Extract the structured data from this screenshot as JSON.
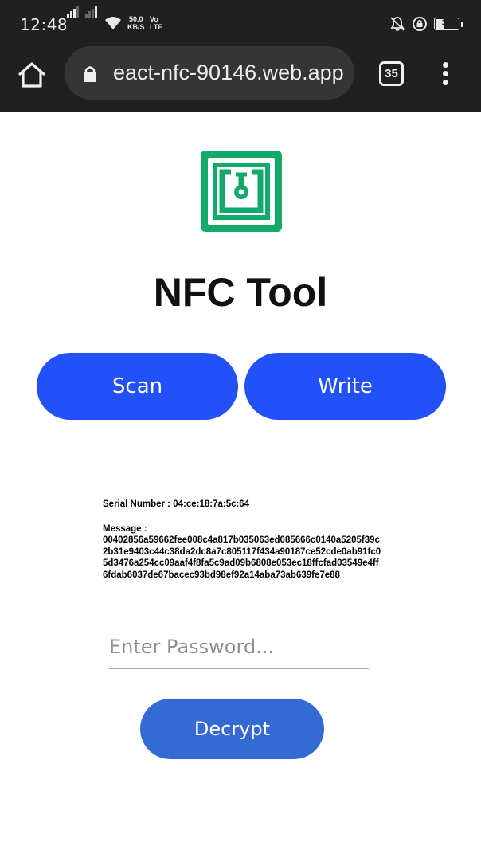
{
  "status_bar": {
    "time": "12:48",
    "net_speed_value": "50.0",
    "net_speed_unit": "KB/S",
    "volte_top": "Vo",
    "volte_bottom": "LTE",
    "battery": "38",
    "icons": [
      "signal-icon",
      "signal-icon",
      "wifi-icon",
      "mute-bell-icon",
      "data-saver-icon",
      "battery-icon"
    ]
  },
  "browser": {
    "url": "eact-nfc-90146.web.app",
    "tab_count": "35"
  },
  "app": {
    "title": "NFC Tool",
    "scan_label": "Scan",
    "write_label": "Write",
    "serial_label": "Serial Number :",
    "serial_value": "04:ce:18:7a:5c:64",
    "message_label": "Message :",
    "message_value": "00402856a59662fee008c4a817b035063ed085666c0140a5205f39c2b31e9403c44c38da2dc8a7c805117f434a90187ce52cde0ab91fc05d3476a254cc09aaf4f8fa5c9ad09b6808e053ec18ffcfad03549e4ff6fdab6037de67bacec93bd98ef92a14aba73ab639fe7e88",
    "password_placeholder": "Enter Password...",
    "password_value": "",
    "decrypt_label": "Decrypt"
  },
  "colors": {
    "logo_green": "#12a96a",
    "primary_blue": "#2351f8",
    "decrypt_blue": "#3569d4",
    "bar_dark": "#202020"
  }
}
